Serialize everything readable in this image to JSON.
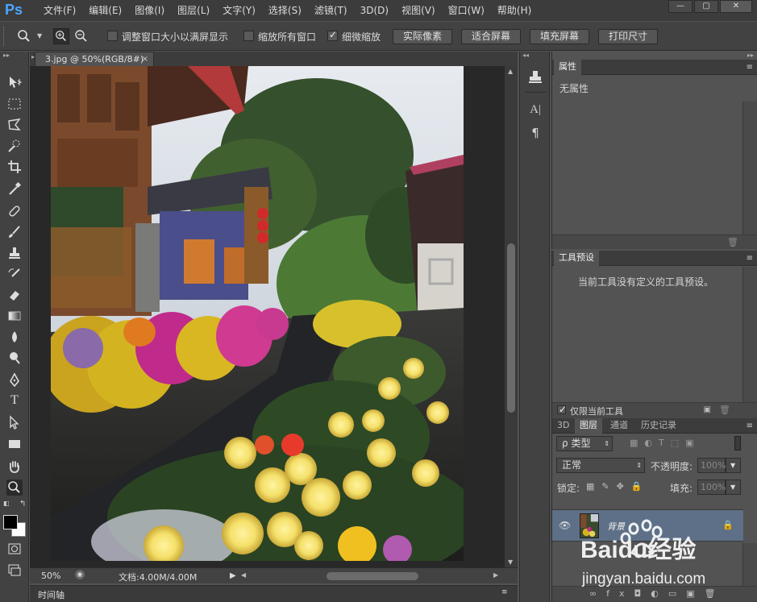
{
  "app": {
    "logo": "Ps"
  },
  "menu": [
    "文件(F)",
    "编辑(E)",
    "图像(I)",
    "图层(L)",
    "文字(Y)",
    "选择(S)",
    "滤镜(T)",
    "3D(D)",
    "视图(V)",
    "窗口(W)",
    "帮助(H)"
  ],
  "window_controls": {
    "minimize": "—",
    "restore": "▢",
    "close": "✕"
  },
  "options": {
    "resize_windows": {
      "label": "调整窗口大小以满屏显示",
      "checked": false
    },
    "zoom_all": {
      "label": "缩放所有窗口",
      "checked": false
    },
    "scrubby_zoom": {
      "label": "细微缩放",
      "checked": true
    },
    "buttons": [
      "实际像素",
      "适合屏幕",
      "填充屏幕",
      "打印尺寸"
    ]
  },
  "document": {
    "tab_title": "3.jpg @ 50%(RGB/8#)",
    "tab_close": "×",
    "zoom": "50%",
    "doc_info": "文档:4.00M/4.00M"
  },
  "timeline": {
    "label": "时间轴"
  },
  "properties_panel": {
    "tab": "属性",
    "content": "无属性"
  },
  "tool_presets_panel": {
    "tab": "工具预设",
    "content": "当前工具没有定义的工具预设。",
    "footer_checkbox": {
      "label": "仅限当前工具",
      "checked": true
    }
  },
  "layers_panel": {
    "tabs": [
      "3D",
      "图层",
      "通道",
      "历史记录"
    ],
    "active_tab": "图层",
    "filter_kind": "类型",
    "blend_mode": "正常",
    "opacity_label": "不透明度:",
    "opacity_value": "100%",
    "lock_label": "锁定:",
    "fill_label": "填充:",
    "fill_value": "100%",
    "layers": [
      {
        "name": "背景",
        "visible": true,
        "locked": true,
        "selected": true
      }
    ]
  },
  "watermark": {
    "brand": "Baidu经验",
    "url": "jingyan.baidu.com"
  },
  "colors": {
    "foreground": "#000000",
    "background": "#ffffff",
    "selection": "#5d7087",
    "accent": "#4aa6ff"
  }
}
